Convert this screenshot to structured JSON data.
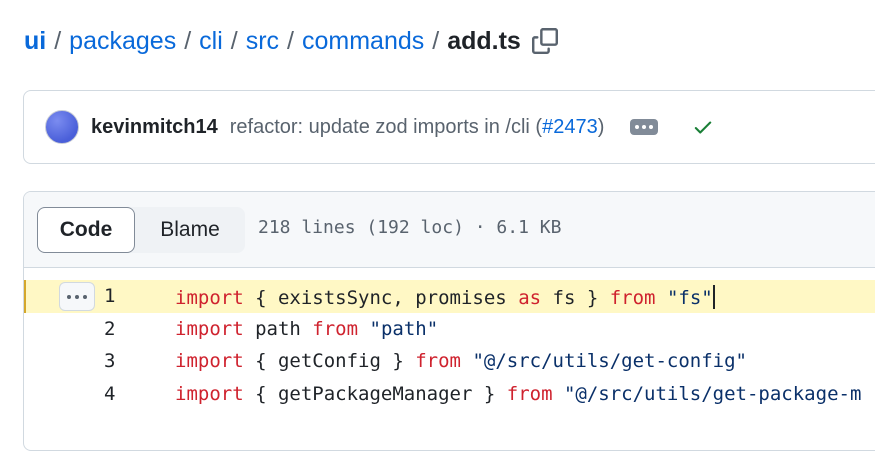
{
  "breadcrumb": {
    "items": [
      "ui",
      "packages",
      "cli",
      "src",
      "commands"
    ],
    "separator": "/",
    "current": "add.ts"
  },
  "commit": {
    "author": "kevinmitch14",
    "message_prefix": "refactor: update zod imports in /cli (",
    "pr_number": "#2473",
    "message_suffix": ")",
    "status": "success"
  },
  "file": {
    "tabs": {
      "code": "Code",
      "blame": "Blame"
    },
    "meta": "218 lines (192 loc) · 6.1 KB"
  },
  "code": {
    "lines": [
      {
        "n": "1",
        "tokens": [
          {
            "t": "import",
            "c": "kw"
          },
          {
            "t": " { existsSync, promises ",
            "c": ""
          },
          {
            "t": "as",
            "c": "kw"
          },
          {
            "t": " fs } ",
            "c": ""
          },
          {
            "t": "from",
            "c": "kw"
          },
          {
            "t": " ",
            "c": ""
          },
          {
            "t": "\"fs\"",
            "c": "str"
          }
        ]
      },
      {
        "n": "2",
        "tokens": [
          {
            "t": "import",
            "c": "kw"
          },
          {
            "t": " path ",
            "c": ""
          },
          {
            "t": "from",
            "c": "kw"
          },
          {
            "t": " ",
            "c": ""
          },
          {
            "t": "\"path\"",
            "c": "str"
          }
        ]
      },
      {
        "n": "3",
        "tokens": [
          {
            "t": "import",
            "c": "kw"
          },
          {
            "t": " { getConfig } ",
            "c": ""
          },
          {
            "t": "from",
            "c": "kw"
          },
          {
            "t": " ",
            "c": ""
          },
          {
            "t": "\"@/src/utils/get-config\"",
            "c": "str"
          }
        ]
      },
      {
        "n": "4",
        "tokens": [
          {
            "t": "import",
            "c": "kw"
          },
          {
            "t": " { getPackageManager } ",
            "c": ""
          },
          {
            "t": "from",
            "c": "kw"
          },
          {
            "t": " ",
            "c": ""
          },
          {
            "t": "\"@/src/utils/get-package-m",
            "c": "str"
          }
        ]
      }
    ]
  },
  "colors": {
    "link": "#0969da",
    "keyword": "#cf222e",
    "string": "#0a3069",
    "highlight": "#fff8c5",
    "success": "#1a7f37"
  }
}
